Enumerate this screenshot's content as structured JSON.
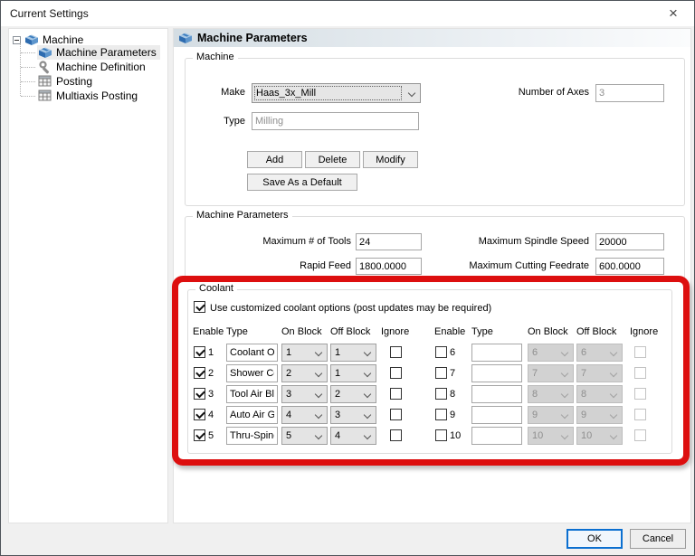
{
  "window": {
    "title": "Current Settings",
    "close_glyph": "×"
  },
  "tree": {
    "root_label": "Machine",
    "items": [
      {
        "label": "Machine Parameters"
      },
      {
        "label": "Machine Definition"
      },
      {
        "label": "Posting"
      },
      {
        "label": "Multiaxis Posting"
      }
    ]
  },
  "header": {
    "title": "Machine Parameters"
  },
  "machine": {
    "group_title": "Machine",
    "make_label": "Make",
    "make_value": "Haas_3x_Mill",
    "axes_label": "Number of Axes",
    "axes_value": "3",
    "type_label": "Type",
    "type_value": "Milling",
    "add": "Add",
    "delete": "Delete",
    "modify": "Modify",
    "save_default": "Save As a Default"
  },
  "params": {
    "group_title": "Machine Parameters",
    "tools_label": "Maximum # of Tools",
    "tools_value": "24",
    "spindle_label": "Maximum Spindle Speed",
    "spindle_value": "20000",
    "rapid_label": "Rapid Feed",
    "rapid_value": "1800.0000",
    "feedrate_label": "Maximum Cutting Feedrate",
    "feedrate_value": "600.0000"
  },
  "coolant": {
    "group_title": "Coolant",
    "use_custom_label": "Use customized coolant options (post updates may be required)",
    "use_custom_checked": true,
    "columns": [
      "Enable",
      "Type",
      "On Block",
      "Off Block",
      "Ignore"
    ],
    "left_rows": [
      {
        "num": "1",
        "enabled": true,
        "type": "Coolant Or",
        "on": "1",
        "off": "1",
        "ignore": false
      },
      {
        "num": "2",
        "enabled": true,
        "type": "Shower Co",
        "on": "2",
        "off": "1",
        "ignore": false
      },
      {
        "num": "3",
        "enabled": true,
        "type": "Tool Air Bla",
        "on": "3",
        "off": "2",
        "ignore": false
      },
      {
        "num": "4",
        "enabled": true,
        "type": "Auto Air Gu",
        "on": "4",
        "off": "3",
        "ignore": false
      },
      {
        "num": "5",
        "enabled": true,
        "type": "Thru-Spind",
        "on": "5",
        "off": "4",
        "ignore": false
      }
    ],
    "right_rows": [
      {
        "num": "6",
        "enabled": false,
        "type": "",
        "on": "6",
        "off": "6",
        "ignore": false
      },
      {
        "num": "7",
        "enabled": false,
        "type": "",
        "on": "7",
        "off": "7",
        "ignore": false
      },
      {
        "num": "8",
        "enabled": false,
        "type": "",
        "on": "8",
        "off": "8",
        "ignore": false
      },
      {
        "num": "9",
        "enabled": false,
        "type": "",
        "on": "9",
        "off": "9",
        "ignore": false
      },
      {
        "num": "10",
        "enabled": false,
        "type": "",
        "on": "10",
        "off": "10",
        "ignore": false
      }
    ]
  },
  "footer": {
    "ok": "OK",
    "cancel": "Cancel"
  },
  "annotation": {
    "color": "#dd0f0f"
  }
}
